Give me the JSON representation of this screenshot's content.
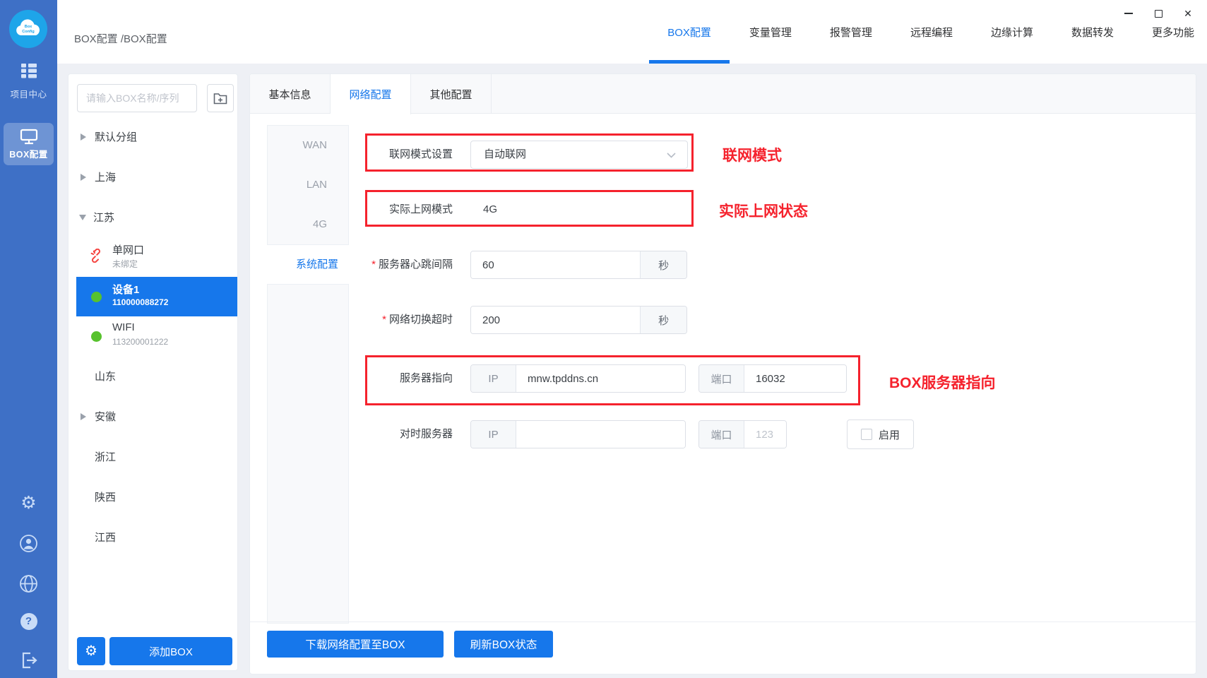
{
  "window": {
    "close_glyph": "✕"
  },
  "rail": {
    "logo": {
      "line1": "Box",
      "line2": "Config"
    },
    "project_center_label": "项目中心",
    "box_config_label": "BOX配置",
    "gear_glyph": "⚙"
  },
  "header": {
    "breadcrumb": "BOX配置 /BOX配置",
    "nav": [
      "BOX配置",
      "变量管理",
      "报警管理",
      "远程编程",
      "边缘计算",
      "数据转发",
      "更多功能"
    ]
  },
  "sidebar": {
    "search_placeholder": "请输入BOX名称/序列",
    "tree": [
      {
        "label": "默认分组"
      },
      {
        "label": "上海"
      },
      {
        "label": "江苏"
      },
      {
        "name": "单网口",
        "sub": "未绑定"
      },
      {
        "name": "设备1",
        "sub": "110000088272"
      },
      {
        "name": "WIFI",
        "sub": "113200001222"
      },
      {
        "label": "山东"
      },
      {
        "label": "安徽"
      },
      {
        "label": "浙江"
      },
      {
        "label": "陕西"
      },
      {
        "label": "江西"
      }
    ],
    "gear_glyph": "⚙",
    "add_box": "添加BOX"
  },
  "main": {
    "tabs": [
      "基本信息",
      "网络配置",
      "其他配置"
    ],
    "subnav": [
      "WAN",
      "LAN",
      "4G"
    ],
    "subnav_active": "系统配置",
    "form": {
      "required_mark": "*",
      "net_mode": {
        "label": "联网模式设置",
        "value": "自动联网"
      },
      "actual_mode": {
        "label": "实际上网模式",
        "value": "4G"
      },
      "heartbeat": {
        "label": "服务器心跳间隔",
        "value": "60",
        "unit": "秒"
      },
      "switch_timeout": {
        "label": "网络切换超时",
        "value": "200",
        "unit": "秒"
      },
      "server_point": {
        "label": "服务器指向",
        "ip_tag": "IP",
        "host": "mnw.tpddns.cn",
        "port_tag": "端口",
        "port": "16032"
      },
      "time_server": {
        "label": "对时服务器",
        "ip_tag": "IP",
        "port_tag": "端口",
        "port_placeholder": "123",
        "enable_label": "启用"
      }
    },
    "footer_buttons": [
      "下载网络配置至BOX",
      "刷新BOX状态"
    ]
  },
  "annotations": {
    "net_mode": "联网模式",
    "actual_status": "实际上网状态",
    "server_point": "BOX服务器指向"
  },
  "colors": {
    "primary": "#1677eb",
    "rail": "#3e70c6",
    "annotation": "#f5222d",
    "online": "#57c22d",
    "unbound": "#f5433f"
  }
}
